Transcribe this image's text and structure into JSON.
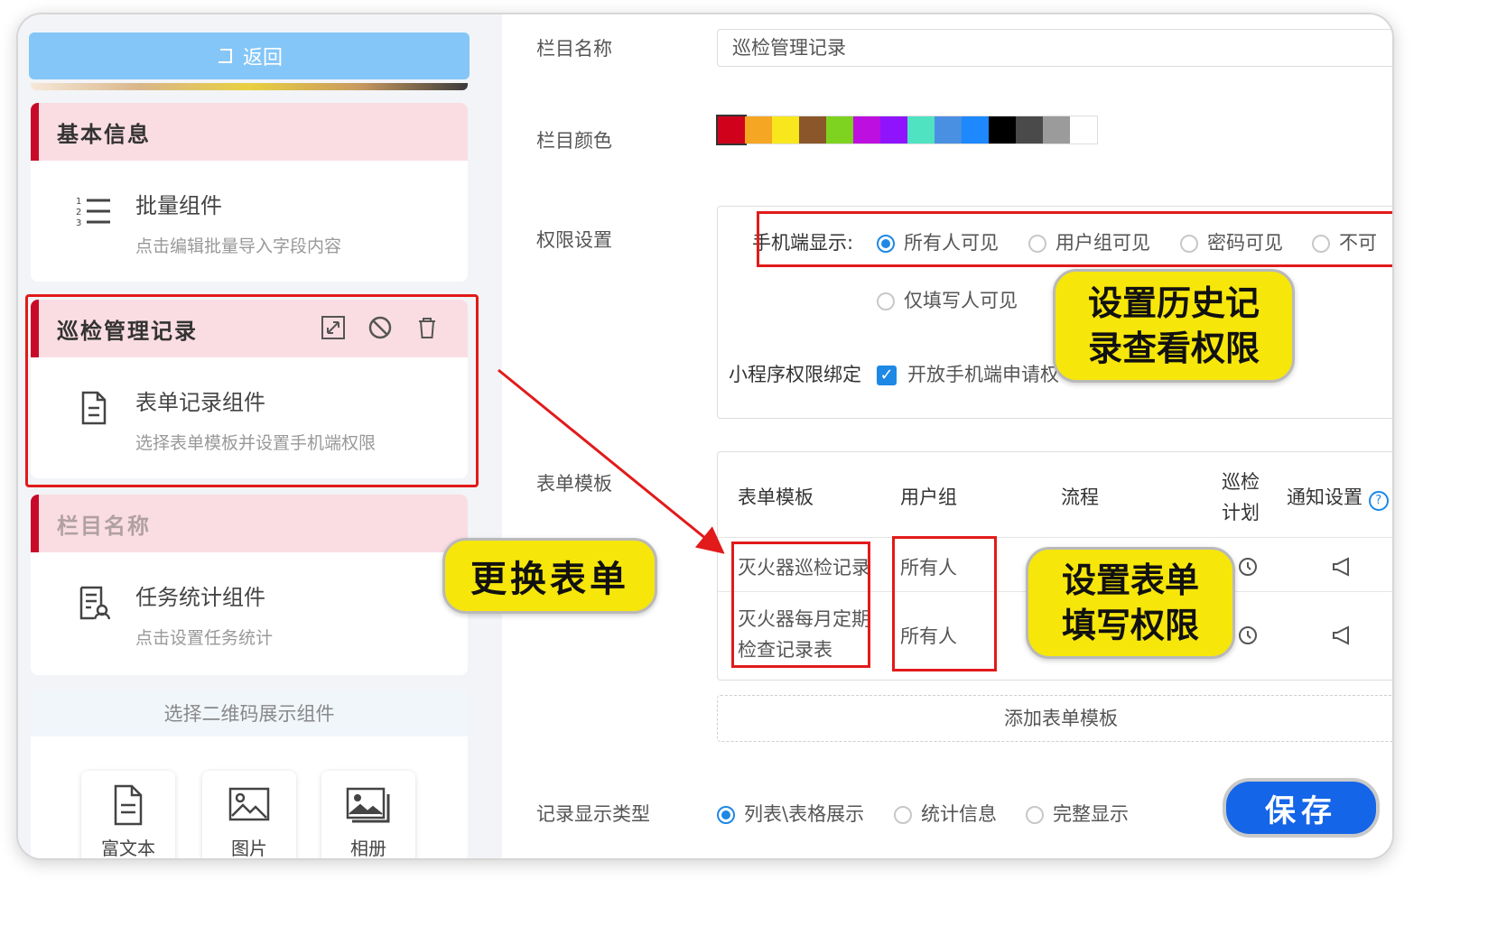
{
  "left_panel": {
    "back_label": "返回",
    "cards": [
      {
        "header": "基本信息",
        "title": "批量组件",
        "desc": "点击编辑批量导入字段内容",
        "icon": "list-icon"
      },
      {
        "header": "巡检管理记录",
        "title": "表单记录组件",
        "desc": "选择表单模板并设置手机端权限",
        "icon": "document-icon"
      },
      {
        "header": "栏目名称",
        "title": "任务统计组件",
        "desc": "点击设置任务统计",
        "icon": "task-stats-icon"
      }
    ],
    "qr_header": "选择二维码展示组件",
    "tiles": [
      {
        "label": "富文本",
        "icon": "rich-text-icon"
      },
      {
        "label": "图片",
        "icon": "image-icon"
      },
      {
        "label": "相册",
        "icon": "album-icon"
      }
    ]
  },
  "form": {
    "name_label": "栏目名称",
    "name_value": "巡检管理记录",
    "color_label": "栏目颜色",
    "colors": [
      "#d0021b",
      "#f5a623",
      "#f8e71c",
      "#8b572a",
      "#7ed321",
      "#bd10e0",
      "#9013fe",
      "#50e3c2",
      "#4a90e2",
      "#1e88ff",
      "#000000",
      "#4a4a4a",
      "#9b9b9b",
      "#ffffff"
    ],
    "perm_label": "权限设置",
    "mobile_display_label": "手机端显示:",
    "mobile_options": [
      "所有人可见",
      "用户组可见",
      "密码可见",
      "不可"
    ],
    "mobile_selected": 0,
    "only_filler_option": "仅填写人可见",
    "miniprogram_label": "小程序权限绑定",
    "miniprogram_check": "开放手机端申请权",
    "template_label": "表单模板",
    "table_headers": [
      "表单模板",
      "用户组",
      "流程",
      "巡检\n计划",
      "通知设置"
    ],
    "rows": [
      {
        "template": "灭火器巡检记录",
        "group": "所有人"
      },
      {
        "template": "灭火器每月定期\n检查记录表",
        "group": "所有人"
      }
    ],
    "add_template": "添加表单模板",
    "record_type_label": "记录显示类型",
    "record_type_options": [
      "列表\\表格展示",
      "统计信息",
      "完整显示"
    ],
    "record_type_selected": 0,
    "save_label": "保存"
  },
  "callouts": {
    "history": "设置历史记\n录查看权限",
    "replace": "更换表单",
    "fill": "设置表单\n填写权限"
  },
  "accent_colors": {
    "primary": "#1e88e5",
    "annotation_red": "#e21a1a",
    "callout_yellow": "#f7e60a"
  }
}
